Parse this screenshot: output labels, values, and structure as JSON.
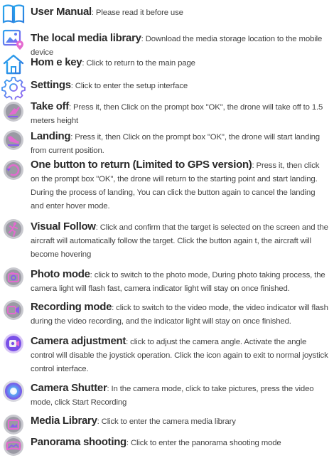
{
  "entries": [
    {
      "name": "User Manual",
      "desc": ": Please read it before use",
      "icon": "book-icon"
    },
    {
      "name": "The local media library",
      "desc": ": Download the media storage location to the mobile device",
      "icon": "gallery-location-icon"
    },
    {
      "name": "Hom e key",
      "desc": ": Click to return to the main page",
      "icon": "home-icon"
    },
    {
      "name": "Settings",
      "desc": ": Click to enter the setup interface",
      "icon": "gear-icon"
    },
    {
      "name": "Take off",
      "desc": ": Press it, then Click on the prompt box \"OK\", the drone will take off to 1.5 meters height",
      "icon": "takeoff-icon"
    },
    {
      "name": "Landing",
      "desc": ": Press it, then Click on the prompt box \"OK\", the drone will start landing from current position.",
      "icon": "landing-icon"
    },
    {
      "name": "One button to return (Limited to GPS version)",
      "desc": ": Press it, then click on the prompt box \"OK\", the drone will return to the starting point and start landing. During the process of landing, You can click the button again to cancel the landing and enter hover mode.",
      "icon": "return-home-icon"
    },
    {
      "name": "Visual Follow",
      "desc": ": Click and confirm that the target is selected on the screen and the aircraft will automatically follow the target. Click the button again t, the aircraft will become hovering",
      "icon": "follow-icon"
    },
    {
      "name": "Photo mode",
      "desc": ": click to switch to the photo mode, During photo taking process, the camera light will flash fast,  camera indicator light will stay on once finished.",
      "icon": "photo-mode-icon"
    },
    {
      "name": "Recording mode",
      "desc": ": click to switch to the video mode, the video indicator will flash during the video recording, and the indicator light will stay on once finished.",
      "icon": "video-mode-icon"
    },
    {
      "name": "Camera adjustment",
      "desc": ": click to adjust the camera angle. Activate the angle control will disable the joystick operation. Click the icon again to exit to normal joystick control interface.",
      "icon": "camera-adjust-icon"
    },
    {
      "name": "Camera Shutter",
      "desc": ": In the camera mode, click to take pictures, press the video mode, click Start Recording",
      "icon": "shutter-icon"
    },
    {
      "name": "Media Library",
      "desc": ": Click to enter the camera media library",
      "icon": "media-library-icon"
    },
    {
      "name": "Panorama shooting",
      "desc": ": Click to enter the panorama shooting mode",
      "icon": "panorama-icon"
    }
  ],
  "colors": {
    "accent": "#1e9be6",
    "purple": "#8a5cf0",
    "pink": "#e46ad0"
  }
}
